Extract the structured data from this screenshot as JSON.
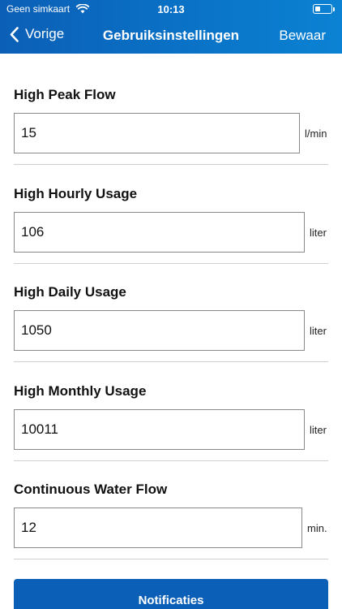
{
  "status_bar": {
    "carrier": "Geen simkaart",
    "time": "10:13"
  },
  "nav": {
    "back_label": "Vorige",
    "title": "Gebruiksinstellingen",
    "save_label": "Bewaar"
  },
  "fields": [
    {
      "label": "High Peak Flow",
      "value": "15",
      "unit": "l/min"
    },
    {
      "label": "High Hourly Usage",
      "value": "106",
      "unit": "liter"
    },
    {
      "label": "High Daily Usage",
      "value": "1050",
      "unit": "liter"
    },
    {
      "label": "High Monthly Usage",
      "value": "10011",
      "unit": "liter"
    },
    {
      "label": "Continuous Water Flow",
      "value": "12",
      "unit": "min."
    }
  ],
  "notifications_button": "Notificaties",
  "colors": {
    "header": "#0b5fb6",
    "button": "#0b5fb6"
  },
  "icons": {
    "back": "chevron-left-icon",
    "wifi": "wifi-icon",
    "battery": "battery-icon"
  }
}
